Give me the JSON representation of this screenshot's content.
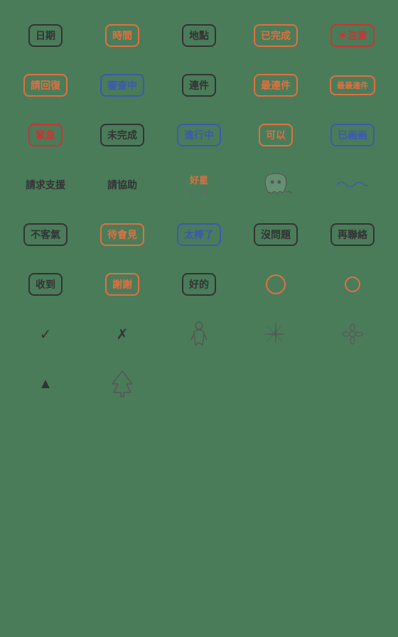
{
  "background": "#4a7c59",
  "rows": [
    {
      "id": "row1",
      "items": [
        {
          "id": "date",
          "text": "日期",
          "style": "badge-dark",
          "type": "badge"
        },
        {
          "id": "time",
          "text": "時間",
          "style": "badge-orange",
          "type": "badge"
        },
        {
          "id": "place",
          "text": "地點",
          "style": "badge-dark",
          "type": "badge"
        },
        {
          "id": "done",
          "text": "已完成",
          "style": "badge-orange",
          "type": "badge"
        },
        {
          "id": "note",
          "text": "＊注意",
          "style": "badge-red",
          "type": "badge"
        }
      ]
    },
    {
      "id": "row2",
      "items": [
        {
          "id": "reply",
          "text": "請回復",
          "style": "badge-orange",
          "type": "badge"
        },
        {
          "id": "checking",
          "text": "審查中",
          "style": "badge-blue",
          "type": "badge"
        },
        {
          "id": "mail",
          "text": "連件",
          "style": "badge-dark",
          "type": "badge"
        },
        {
          "id": "latest-mail",
          "text": "最連件",
          "style": "badge-orange",
          "type": "badge"
        },
        {
          "id": "final-mail",
          "text": "最最連件",
          "style": "badge-orange",
          "type": "badge"
        }
      ]
    },
    {
      "id": "row3",
      "items": [
        {
          "id": "urgent",
          "text": "緊急",
          "style": "badge-red",
          "type": "badge"
        },
        {
          "id": "incomplete",
          "text": "未完成",
          "style": "badge-dark",
          "type": "badge"
        },
        {
          "id": "in-progress",
          "text": "進行中",
          "style": "badge-blue",
          "type": "badge"
        },
        {
          "id": "ok",
          "text": "可以",
          "style": "badge-orange",
          "type": "badge"
        },
        {
          "id": "noted",
          "text": "已画画",
          "style": "badge-blue",
          "type": "badge"
        }
      ]
    },
    {
      "id": "row4",
      "items": [
        {
          "id": "ask-help",
          "text": "請求支援",
          "style": "text-dark",
          "type": "text"
        },
        {
          "id": "please-help",
          "text": "請協助",
          "style": "text-dark",
          "type": "text"
        },
        {
          "id": "good-star",
          "text": "好星",
          "style": "text-orange",
          "type": "text"
        },
        {
          "id": "ghost",
          "text": "",
          "type": "ghost"
        },
        {
          "id": "wavy",
          "text": "",
          "type": "wavy"
        }
      ]
    },
    {
      "id": "row5",
      "items": [
        {
          "id": "no-luck",
          "text": "不客氣",
          "style": "badge-dark",
          "type": "badge"
        },
        {
          "id": "see-you",
          "text": "待會見",
          "style": "badge-orange",
          "type": "badge"
        },
        {
          "id": "great",
          "text": "太棒了",
          "style": "badge-blue",
          "type": "badge"
        },
        {
          "id": "no-problem",
          "text": "沒問題",
          "style": "badge-dark",
          "type": "badge"
        },
        {
          "id": "contact",
          "text": "再聯絡",
          "style": "badge-dark",
          "type": "badge"
        }
      ]
    },
    {
      "id": "row6",
      "items": [
        {
          "id": "received",
          "text": "收到",
          "style": "badge-dark",
          "type": "badge"
        },
        {
          "id": "thanks",
          "text": "謝謝",
          "style": "badge-orange",
          "type": "badge"
        },
        {
          "id": "good",
          "text": "好的",
          "style": "badge-dark",
          "type": "badge"
        },
        {
          "id": "circle1",
          "text": "",
          "type": "circle-lg"
        },
        {
          "id": "circle2",
          "text": "",
          "type": "circle-sm"
        }
      ]
    },
    {
      "id": "row7",
      "items": [
        {
          "id": "checkmark",
          "text": "✓",
          "style": "text-dark",
          "type": "symbol"
        },
        {
          "id": "cross",
          "text": "✗",
          "style": "text-dark",
          "type": "symbol"
        },
        {
          "id": "person",
          "text": "🧍",
          "style": "text-dark",
          "type": "symbol"
        },
        {
          "id": "sparkle1",
          "text": "❋",
          "style": "text-dark",
          "type": "symbol"
        },
        {
          "id": "sparkle2",
          "text": "✿",
          "style": "text-dark",
          "type": "symbol"
        }
      ]
    },
    {
      "id": "row8",
      "items": [
        {
          "id": "triangle",
          "text": "▲",
          "style": "text-dark",
          "type": "symbol"
        },
        {
          "id": "tree",
          "text": "🌲",
          "style": "text-dark",
          "type": "symbol"
        }
      ]
    }
  ]
}
